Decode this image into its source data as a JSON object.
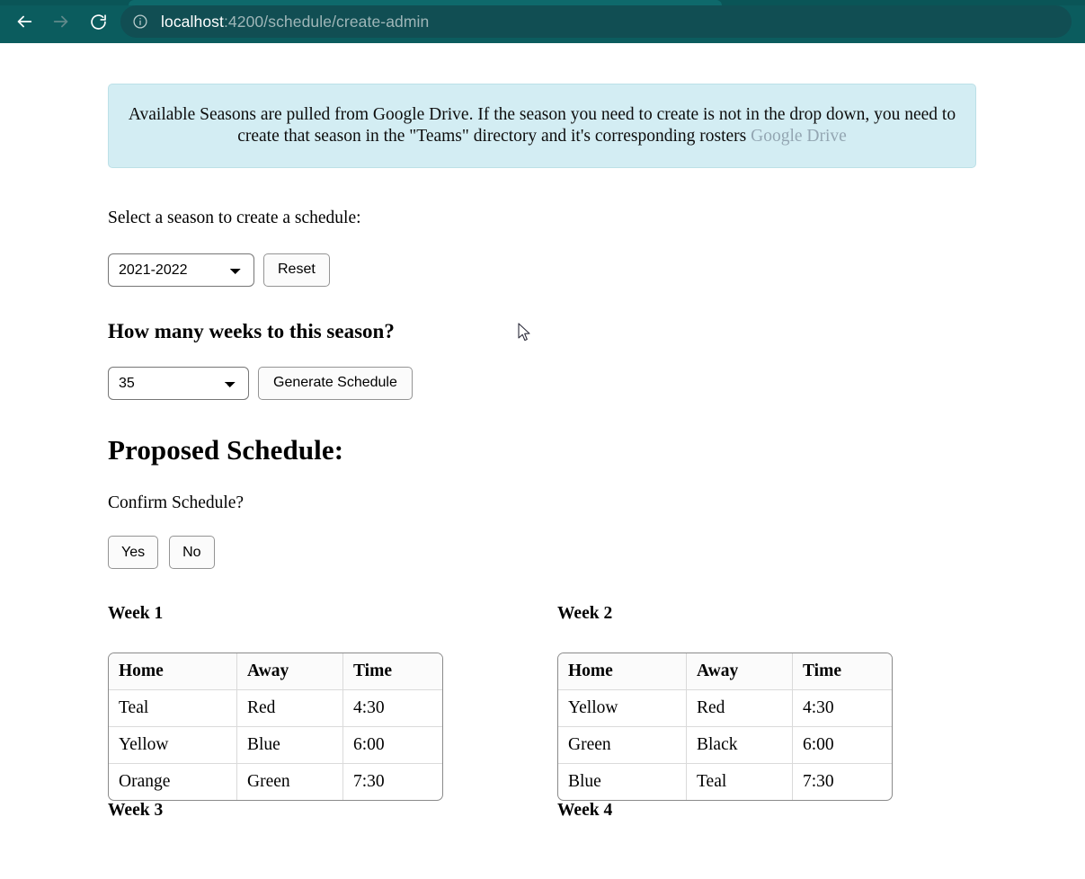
{
  "browser": {
    "nav": {
      "back_icon": "arrow-left-icon",
      "forward_icon": "arrow-right-icon",
      "reload_icon": "reload-icon"
    },
    "omnibox": {
      "site_info_icon": "info-circle-icon",
      "url_host": "localhost",
      "url_path": ":4200/schedule/create-admin",
      "url_full": "localhost:4200/schedule/create-admin"
    },
    "colors": {
      "chrome_bg": "#0b5c5e",
      "omnibox_bg": "#114e53",
      "url_host_color": "#ffffff",
      "url_path_color": "#9fb6b8"
    }
  },
  "page": {
    "banner": {
      "text": "Available Seasons are pulled from Google Drive. If the season you need to create is not in the drop down, you need to create that season in the \"Teams\" directory and it's corresponding rosters ",
      "link_label": "Google Drive",
      "bg_color": "#d3edf3",
      "border_color": "#bce0e7",
      "link_color": "#93a6b2"
    },
    "season": {
      "label": "Select a season to create a schedule:",
      "selected": "2021-2022",
      "options": [
        "2021-2022"
      ],
      "reset_label": "Reset"
    },
    "weeks": {
      "heading": "How many weeks to this season?",
      "selected": "35",
      "options": [
        "35"
      ],
      "generate_label": "Generate Schedule"
    },
    "proposed": {
      "heading": "Proposed Schedule:",
      "confirm_text": "Confirm Schedule?",
      "yes_label": "Yes",
      "no_label": "No"
    },
    "schedule": {
      "columns": [
        "Home",
        "Away",
        "Time"
      ],
      "weeks": [
        {
          "title": "Week 1",
          "games": [
            {
              "home": "Teal",
              "away": "Red",
              "time": "4:30"
            },
            {
              "home": "Yellow",
              "away": "Blue",
              "time": "6:00"
            },
            {
              "home": "Orange",
              "away": "Green",
              "time": "7:30"
            }
          ]
        },
        {
          "title": "Week 2",
          "games": [
            {
              "home": "Yellow",
              "away": "Red",
              "time": "4:30"
            },
            {
              "home": "Green",
              "away": "Black",
              "time": "6:00"
            },
            {
              "home": "Blue",
              "away": "Teal",
              "time": "7:30"
            }
          ]
        },
        {
          "title": "Week 3",
          "games": []
        },
        {
          "title": "Week 4",
          "games": []
        }
      ]
    }
  }
}
